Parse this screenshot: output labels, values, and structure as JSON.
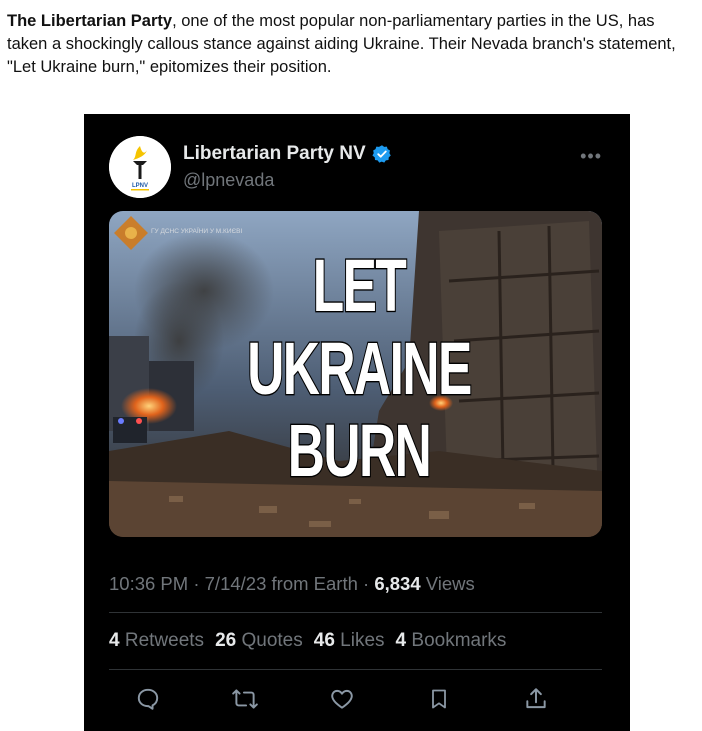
{
  "article": {
    "lead_bold": "The Libertarian Party",
    "lead_rest": ", one of the most popular non-parliamentary parties in the US, has taken a shockingly callous stance against aiding Ukraine. Their Nevada branch's statement, \"Let Ukraine burn,\" epitomizes their position."
  },
  "tweet": {
    "author_name": "Libertarian Party NV",
    "handle": "@lpnevada",
    "more_label": "•••",
    "avatar_text": "LPNV",
    "image": {
      "overlay_lines": [
        "LET",
        "UKRAINE",
        "BURN"
      ],
      "watermark": "ГУ ДСНС УКРАЇНИ У М.КИЄВІ"
    },
    "time": "10:36 PM",
    "date": "7/14/23",
    "source": "from Earth",
    "views_count": "6,834",
    "views_label": "Views",
    "retweets_count": "4",
    "retweets_label": "Retweets",
    "quotes_count": "26",
    "quotes_label": "Quotes",
    "likes_count": "46",
    "likes_label": "Likes",
    "bookmarks_count": "4",
    "bookmarks_label": "Bookmarks"
  },
  "icons": [
    "verified-badge-icon",
    "reply-icon",
    "retweet-icon",
    "like-icon",
    "bookmark-icon",
    "share-icon"
  ],
  "colors": {
    "tweet_bg": "#000000",
    "muted": "#71767b",
    "text": "#e7e9ea",
    "verified": "#1d9bf0",
    "divider": "#2f3336"
  }
}
